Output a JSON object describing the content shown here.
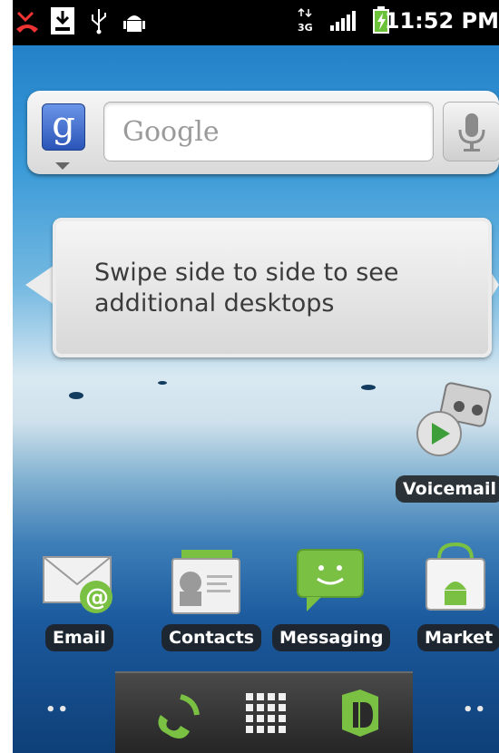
{
  "status_bar": {
    "time": "11:52 PM",
    "network": "3G",
    "icons": [
      "missed-call-icon",
      "download-icon",
      "usb-icon",
      "android-debug-icon",
      "data-arrows-icon",
      "signal-icon",
      "battery-charging-icon"
    ]
  },
  "search_widget": {
    "logo": "g",
    "placeholder": "Google",
    "mic_icon": "microphone-icon"
  },
  "tip_bubble": {
    "text": "Swipe side to side to see additional desktops"
  },
  "shortcuts": {
    "voicemail": "Voicemail"
  },
  "apps": [
    {
      "label": "Email",
      "icon": "email-icon"
    },
    {
      "label": "Contacts",
      "icon": "contacts-icon"
    },
    {
      "label": "Messaging",
      "icon": "messaging-icon"
    },
    {
      "label": "Market",
      "icon": "market-icon"
    }
  ],
  "dock": {
    "left_indicator": "••",
    "right_indicator": "••",
    "items": [
      "phone-icon",
      "app-launcher-icon",
      "browser-icon"
    ]
  },
  "colors": {
    "accent_green": "#7ac143",
    "google_blue": "#3a67c9"
  }
}
